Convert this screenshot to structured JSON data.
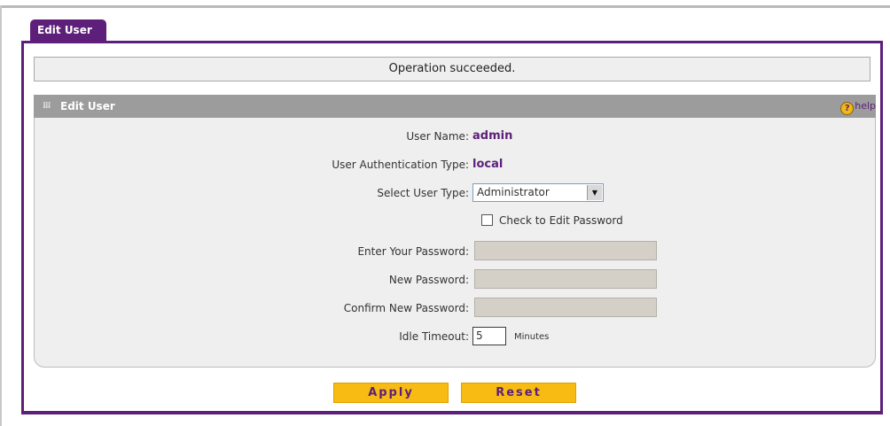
{
  "tab": {
    "label": "Edit User"
  },
  "status": {
    "message": "Operation succeeded."
  },
  "panel": {
    "title": "Edit User",
    "help_label": "help",
    "help_icon": "help-question-icon"
  },
  "form": {
    "user_name_label": "User Name:",
    "user_name_value": "admin",
    "auth_type_label": "User Authentication Type:",
    "auth_type_value": "local",
    "user_type_label": "Select User Type:",
    "user_type_value": "Administrator",
    "edit_password_label": "Check to Edit Password",
    "edit_password_checked": false,
    "enter_password_label": "Enter Your Password:",
    "new_password_label": "New Password:",
    "confirm_password_label": "Confirm New Password:",
    "idle_timeout_label": "Idle Timeout:",
    "idle_timeout_value": "5",
    "idle_timeout_unit": "Minutes"
  },
  "buttons": {
    "apply": "Apply",
    "reset": "Reset"
  },
  "colors": {
    "brand": "#5d1f7a",
    "button": "#f7bb13",
    "header": "#9c9c9c"
  }
}
